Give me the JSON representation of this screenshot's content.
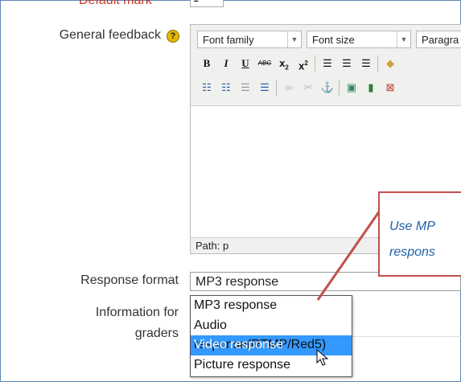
{
  "form": {
    "default_mark_label": "Default mark",
    "default_mark_value": "1",
    "general_feedback_label": "General feedback",
    "help_icon": "?",
    "response_format_label": "Response format",
    "information_label_line1": "Information for",
    "information_label_line2": "graders"
  },
  "editor": {
    "font_family": "Font family",
    "font_size": "Font size",
    "paragraph": "Paragra",
    "path_label": "Path: p",
    "row2_icons": [
      "bold-icon",
      "italic-icon",
      "underline-icon",
      "strikethrough-icon",
      "subscript-icon",
      "superscript-icon",
      "align-left-icon",
      "align-center-icon",
      "align-right-icon",
      "clean-icon"
    ],
    "row3_icons": [
      "bullet-list-icon",
      "numbered-list-icon",
      "outdent-icon",
      "indent-icon",
      "link-icon",
      "unlink-icon",
      "anchor-icon",
      "image-icon",
      "media-icon",
      "insert-icon"
    ]
  },
  "response_format": {
    "selected": "MP3 response",
    "options": [
      "MP3 response",
      "Audio response(RTMP/Red5)",
      "Video response",
      "Picture response"
    ],
    "highlighted_index": 2
  },
  "callout": {
    "line1": "Use MP",
    "line2": "respons"
  },
  "colors": {
    "highlight": "#3399ff",
    "callout_border": "#c0504d",
    "callout_text": "#1f5fa8",
    "required_label": "#c0392b"
  }
}
